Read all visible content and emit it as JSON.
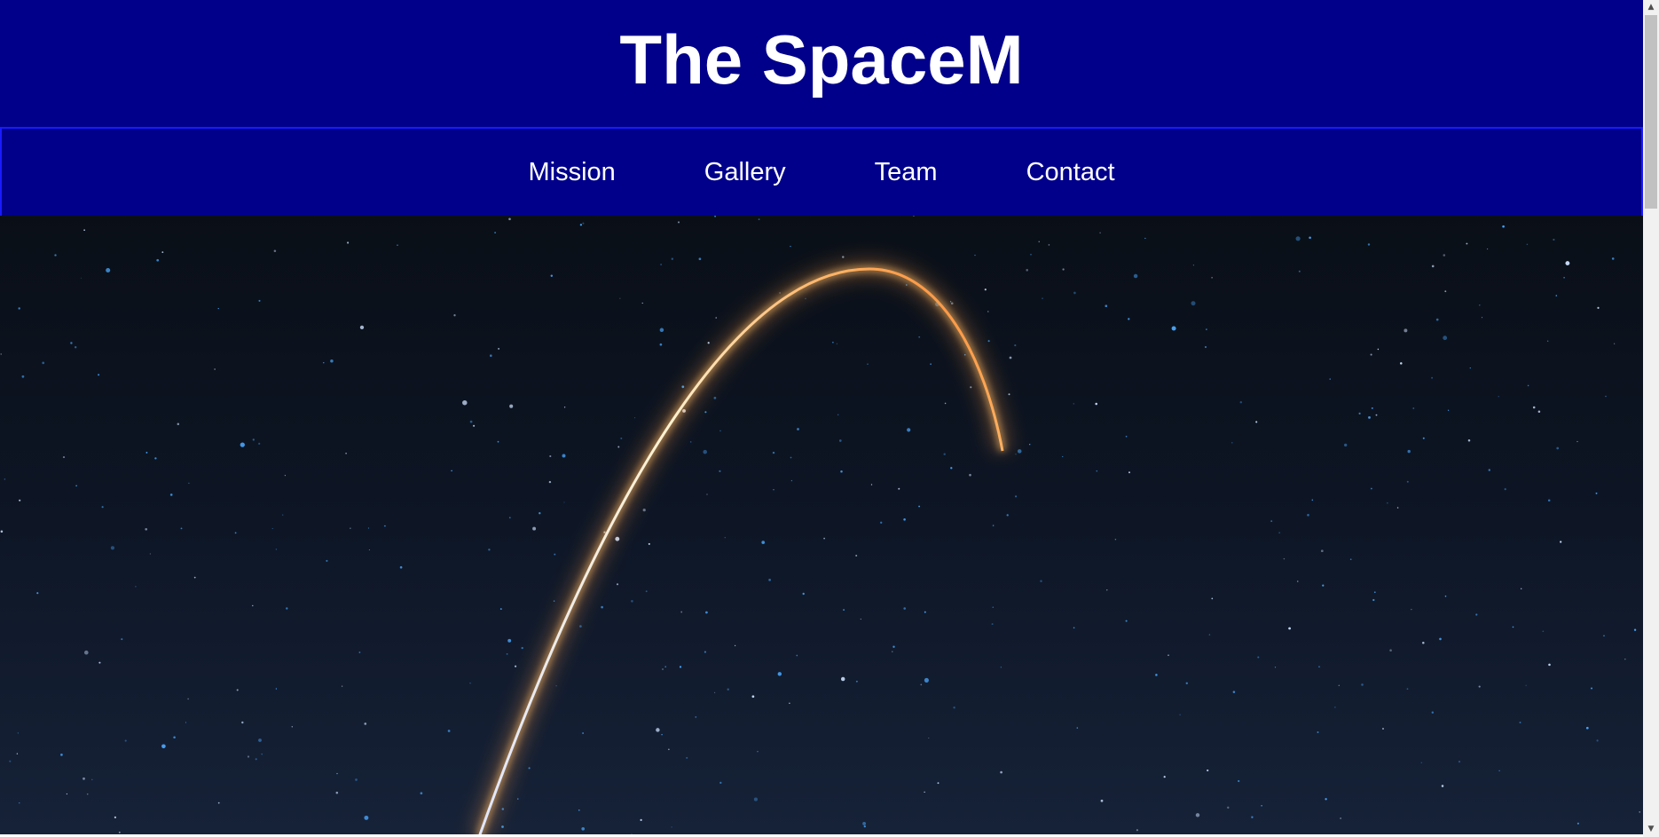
{
  "header": {
    "title": "The SpaceM"
  },
  "nav": {
    "items": [
      {
        "label": "Mission"
      },
      {
        "label": "Gallery"
      },
      {
        "label": "Team"
      },
      {
        "label": "Contact"
      }
    ]
  },
  "hero": {
    "image_icon": "rocket-launch-trail-night-sky-image"
  },
  "colors": {
    "header_bg": "#00008b",
    "nav_border": "#1a1aff",
    "text": "#ffffff",
    "trail_core": "#fff6e0",
    "trail_glow": "#ff9a3c"
  }
}
